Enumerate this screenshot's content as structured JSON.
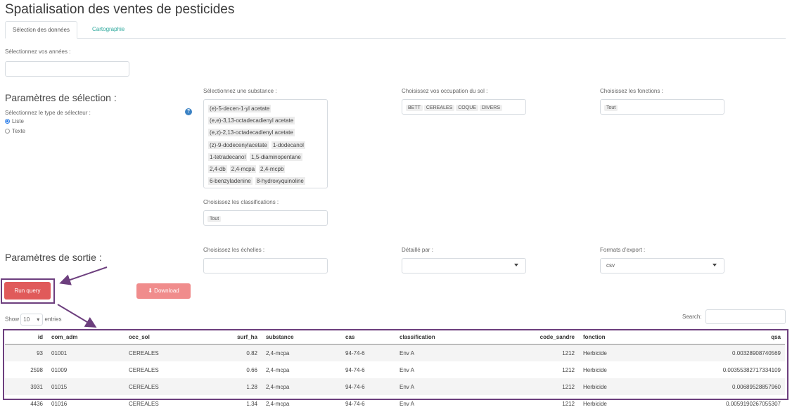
{
  "page": {
    "title": "Spatialisation des ventes de pesticides"
  },
  "tabs": [
    {
      "label": "Sélection des données",
      "active": true
    },
    {
      "label": "Cartographie",
      "active": false
    }
  ],
  "years": {
    "label": "Sélectionnez vos années :",
    "value": ""
  },
  "selection": {
    "heading": "Paramètres de sélection :",
    "selector_type_label": "Sélectionnez le type de sélecteur :",
    "selector_options": [
      {
        "label": "Liste",
        "checked": true
      },
      {
        "label": "Texte",
        "checked": false
      }
    ],
    "help_icon": "question-circle-icon",
    "substance": {
      "label": "Sélectionnez une substance :",
      "options": [
        [
          "(e)-5-decen-1-yl acetate"
        ],
        [
          "(e,e)-3,13-octadecadienyl acetate"
        ],
        [
          "(e,z)-2,13-octadecadienyl acetate"
        ],
        [
          "(z)-9-dodecenylacetate",
          "1-dodecanol"
        ],
        [
          "1-tetradecanol",
          "1,5-diaminopentane"
        ],
        [
          "2,4-db",
          "2,4-mcpa",
          "2,4-mcpb"
        ],
        [
          "6-benzyladenine",
          "8-hydroxyquinoline"
        ]
      ]
    },
    "land_use": {
      "label": "Choisissez vos occupation du sol :",
      "chips": [
        "BETT",
        "CEREALES",
        "COQUE",
        "DIVERS"
      ]
    },
    "functions": {
      "label": "Choisissez les fonctions :",
      "chips": [
        "Tout"
      ]
    },
    "classifications": {
      "label": "Choisissez les classifications :",
      "chips": [
        "Tout"
      ]
    }
  },
  "output": {
    "heading": "Paramètres de sortie :",
    "scales": {
      "label": "Choisissez les échelles :",
      "value": ""
    },
    "detail": {
      "label": "Détaillé par :",
      "value": ""
    },
    "export": {
      "label": "Formats d'export :",
      "value": "csv"
    }
  },
  "buttons": {
    "run": "Run query",
    "download": "Download",
    "download_icon": "download-icon"
  },
  "table_controls": {
    "show_label": "Show",
    "entries_value": "10",
    "entries_label": "entries",
    "search_label": "Search:",
    "search_value": ""
  },
  "table": {
    "columns": [
      "id",
      "com_adm",
      "occ_sol",
      "surf_ha",
      "substance",
      "cas",
      "classification",
      "code_sandre",
      "fonction",
      "qsa"
    ],
    "rows": [
      [
        "93",
        "01001",
        "CEREALES",
        "0.82",
        "2,4-mcpa",
        "94-74-6",
        "Env A",
        "1212",
        "Herbicide",
        "0.00328908740569"
      ],
      [
        "2598",
        "01009",
        "CEREALES",
        "0.66",
        "2,4-mcpa",
        "94-74-6",
        "Env A",
        "1212",
        "Herbicide",
        "0.00355382717334109"
      ],
      [
        "3931",
        "01015",
        "CEREALES",
        "1.28",
        "2,4-mcpa",
        "94-74-6",
        "Env A",
        "1212",
        "Herbicide",
        "0.00689528857960"
      ],
      [
        "4436",
        "01016",
        "CEREALES",
        "1.34",
        "2,4-mcpa",
        "94-74-6",
        "Env A",
        "1212",
        "Herbicide",
        "0.0059190267055307"
      ]
    ]
  },
  "colors": {
    "accent_red": "#e05a5a",
    "annotation_purple": "#6d3f7e",
    "tab_link": "#2aa79b"
  }
}
